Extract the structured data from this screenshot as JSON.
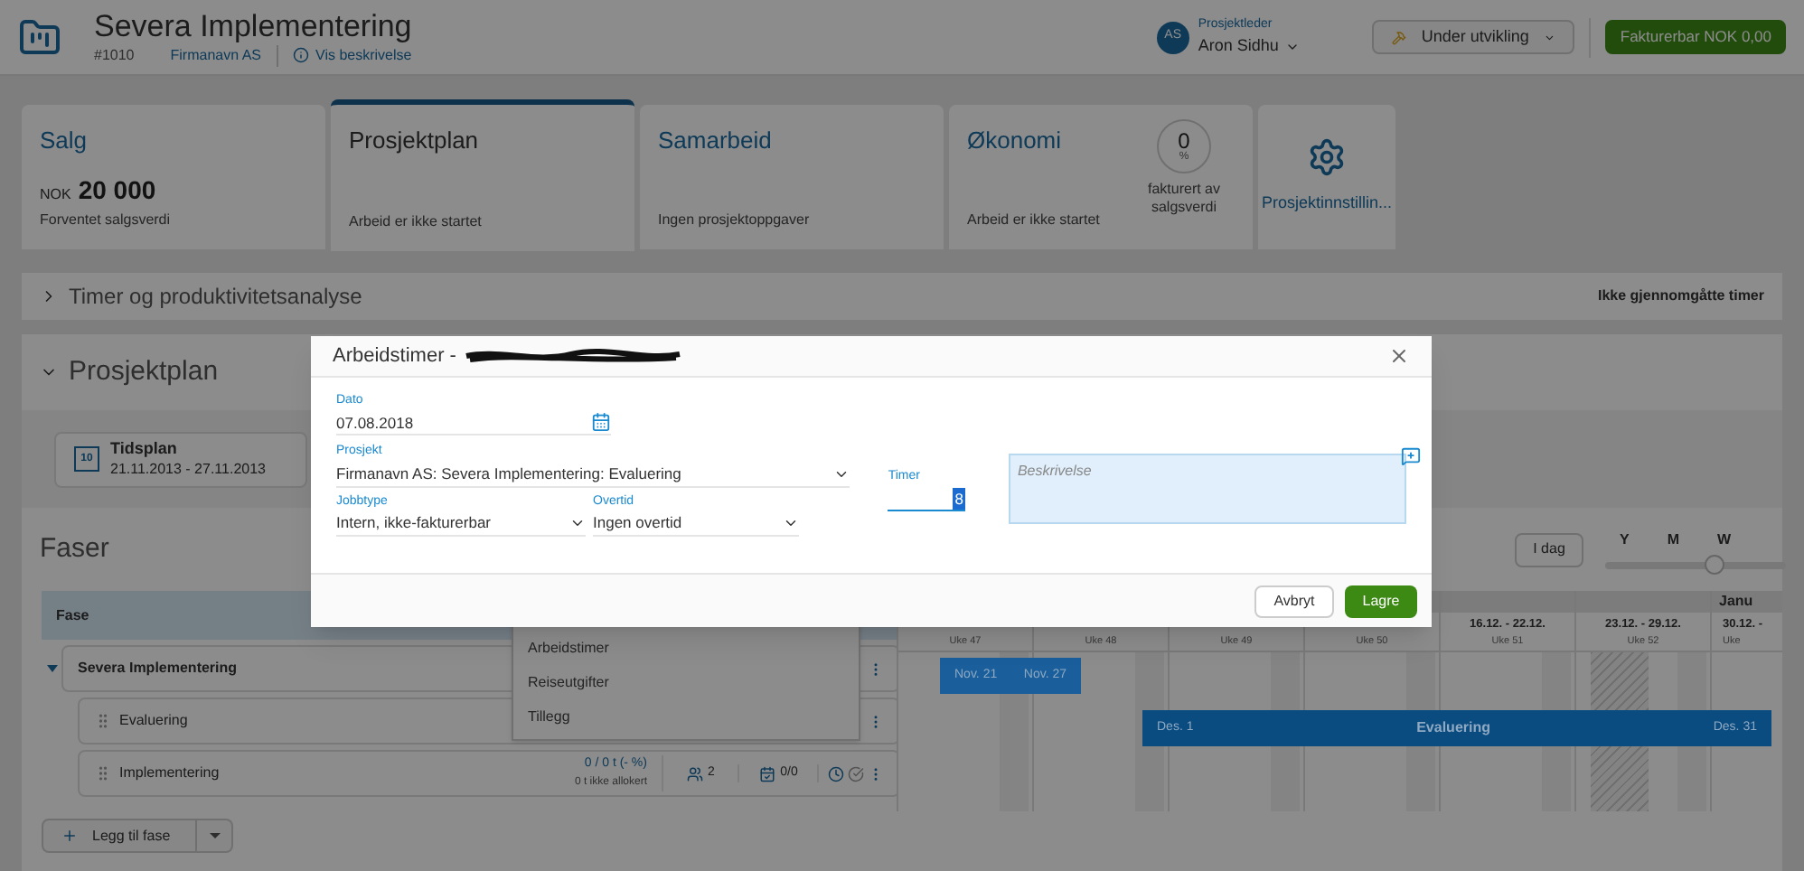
{
  "header": {
    "title": "Severa Implementering",
    "number": "#1010",
    "customer": "Firmanavn AS",
    "description_link": "Vis beskrivelse",
    "manager_label": "Prosjektleder",
    "manager_initials": "AS",
    "manager_name": "Aron Sidhu",
    "status_button": "Under utvikling",
    "invoice_button": "Fakturerbar NOK 0,00"
  },
  "cards": [
    {
      "kind": "sales",
      "title": "Salg",
      "currency": "NOK",
      "amount": "20 000",
      "caption": "Forventet salgsverdi",
      "selected": false
    },
    {
      "kind": "plain",
      "title": "Prosjektplan",
      "caption": "Arbeid er ikke startet",
      "selected": true
    },
    {
      "kind": "plain",
      "title": "Samarbeid",
      "caption": "Ingen prosjektoppgaver",
      "selected": false
    },
    {
      "kind": "economy",
      "title": "Økonomi",
      "caption": "Arbeid er ikke startet",
      "percent": "0",
      "percent_sign": "%",
      "percent_caption": "fakturert av salgsverdi",
      "selected": false
    },
    {
      "kind": "settings",
      "title": "Prosjektinnstillin...",
      "selected": false
    }
  ],
  "hours_panel": {
    "title": "Timer og produktivitetsanalyse",
    "right_label": "Ikke gjennomgåtte timer",
    "expanded": false
  },
  "plan_panel": {
    "title": "Prosjektplan",
    "expanded": true,
    "schedule_icon": "10",
    "schedule_title": "Tidsplan",
    "schedule_dates": "21.11.2013 - 27.11.2013"
  },
  "phases": {
    "title": "Faser",
    "today_button": "I dag",
    "zoom_labels": [
      "Y",
      "M",
      "W"
    ],
    "zoom_slider": {
      "level": 0.6
    },
    "column": "Fase",
    "rows": [
      {
        "kind": "parent",
        "name": "Severa Implementering",
        "expanded": true
      },
      {
        "kind": "child",
        "name": "Evaluering"
      },
      {
        "kind": "child",
        "name": "Implementering",
        "hours": "0 / 0 t (- %)",
        "unallocated": "0 t ikke allokert",
        "people": "2",
        "tasks": "0/0"
      }
    ],
    "add_button": "Legg til fase"
  },
  "menu": {
    "items": [
      "Arbeidstimer",
      "Reiseutgifter",
      "Tillegg"
    ]
  },
  "gantt": {
    "month": "Janu",
    "weeks": [
      {
        "week": "Uke 47"
      },
      {
        "week": "Uke 48"
      },
      {
        "week": "Uke 49"
      },
      {
        "week": "Uke 50"
      },
      {
        "dates": "16.12. - 22.12.",
        "week": "Uke 51"
      },
      {
        "dates": "23.12. - 29.12.",
        "week": "Uke 52",
        "holiday": true
      },
      {
        "dates": "30.12. -",
        "week": "Uke"
      }
    ],
    "bars": [
      {
        "start": "Nov. 21",
        "end": "Nov. 27",
        "color": "#1a5f9c"
      },
      {
        "start": "Des. 1",
        "end": "Des. 31",
        "label": "Evaluering",
        "color": "#0a4b80"
      }
    ]
  },
  "dialog": {
    "title": "Arbeidstimer - ",
    "date_label": "Dato",
    "date": "07.08.2018",
    "project_label": "Prosjekt",
    "project": "Firmanavn AS: Severa Implementering: Evaluering",
    "jobtype_label": "Jobbtype",
    "jobtype": "Intern, ikke-fakturerbar",
    "overtime_label": "Overtid",
    "overtime": "Ingen overtid",
    "hours_label": "Timer",
    "hours": "8",
    "description_placeholder": "Beskrivelse",
    "cancel": "Avbryt",
    "save": "Lagre"
  }
}
